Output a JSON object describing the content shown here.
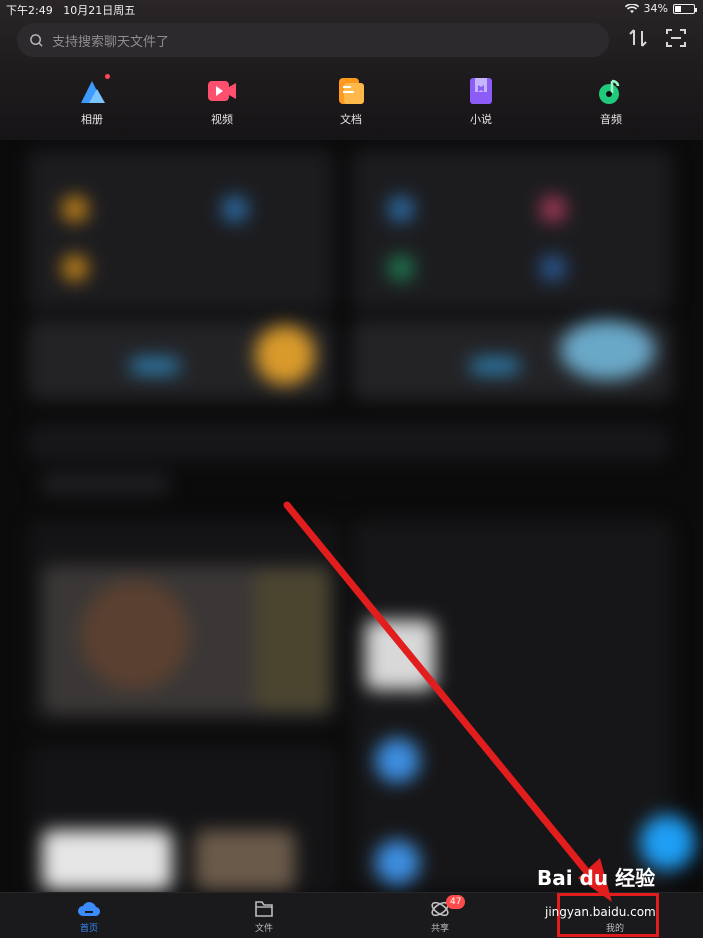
{
  "status_bar": {
    "time": "下午2:49",
    "date": "10月21日周五",
    "battery": "34%",
    "battery_fraction": 0.34
  },
  "search": {
    "placeholder": "支持搜索聊天文件了"
  },
  "categories": [
    {
      "label": "相册",
      "icon": "photo-album-icon"
    },
    {
      "label": "视频",
      "icon": "video-icon"
    },
    {
      "label": "文档",
      "icon": "document-icon"
    },
    {
      "label": "小说",
      "icon": "novel-book-icon"
    },
    {
      "label": "音频",
      "icon": "audio-note-icon"
    }
  ],
  "tabs": [
    {
      "label": "首页",
      "icon": "home-cloud-icon",
      "active": true
    },
    {
      "label": "文件",
      "icon": "folder-icon"
    },
    {
      "label": "共享",
      "icon": "share-icon",
      "badge": "47"
    },
    {
      "label": "我的",
      "icon": "profile-icon"
    }
  ],
  "watermark": {
    "brand": "Bai du 经验",
    "url": "jingyan.baidu.com"
  },
  "colors": {
    "accent": "#3a8cff",
    "highlight": "#e21d1d",
    "badge": "#ff4b4b"
  }
}
